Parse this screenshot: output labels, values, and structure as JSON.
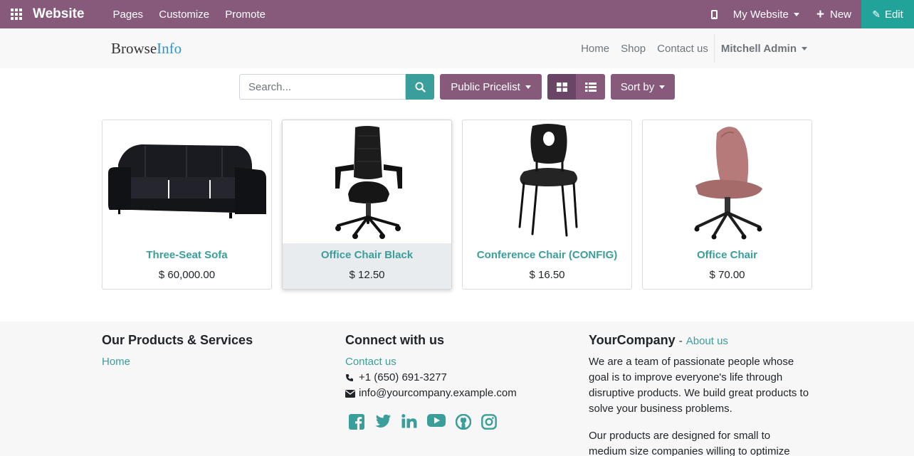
{
  "topbar": {
    "app_title": "Website",
    "menu": [
      "Pages",
      "Customize",
      "Promote"
    ],
    "website_selector": "My Website",
    "new_label": "New",
    "edit_label": "Edit",
    "bar_color": "#875a7b",
    "edit_color": "#21a39a"
  },
  "header": {
    "logo_part1": "Browse",
    "logo_part2": "Info",
    "nav": [
      "Home",
      "Shop",
      "Contact us"
    ],
    "user": "Mitchell Admin"
  },
  "toolbar": {
    "search_placeholder": "Search...",
    "pricelist_label": "Public Pricelist",
    "sort_label": "Sort by"
  },
  "products": [
    {
      "name": "Three-Seat Sofa",
      "price": "$ 60,000.00"
    },
    {
      "name": "Office Chair Black",
      "price": "$ 12.50"
    },
    {
      "name": "Conference Chair (CONFIG)",
      "price": "$ 16.50"
    },
    {
      "name": "Office Chair",
      "price": "$ 70.00"
    }
  ],
  "footer": {
    "col1": {
      "heading": "Our Products & Services",
      "link": "Home"
    },
    "col2": {
      "heading": "Connect with us",
      "contact_link": "Contact us",
      "phone": "+1 (650) 691-3277",
      "email": "info@yourcompany.example.com",
      "socials": [
        "facebook-icon",
        "twitter-icon",
        "linkedin-icon",
        "youtube-icon",
        "github-icon",
        "instagram-icon"
      ]
    },
    "col3": {
      "company": "YourCompany",
      "dash": "-",
      "about_link": "About us",
      "para1": "We are a team of passionate people whose goal is to improve everyone's life through disruptive products. We build great products to solve your business problems.",
      "para2": "Our products are designed for small to medium size companies willing to optimize"
    },
    "accent_color": "#3a9e9a"
  }
}
